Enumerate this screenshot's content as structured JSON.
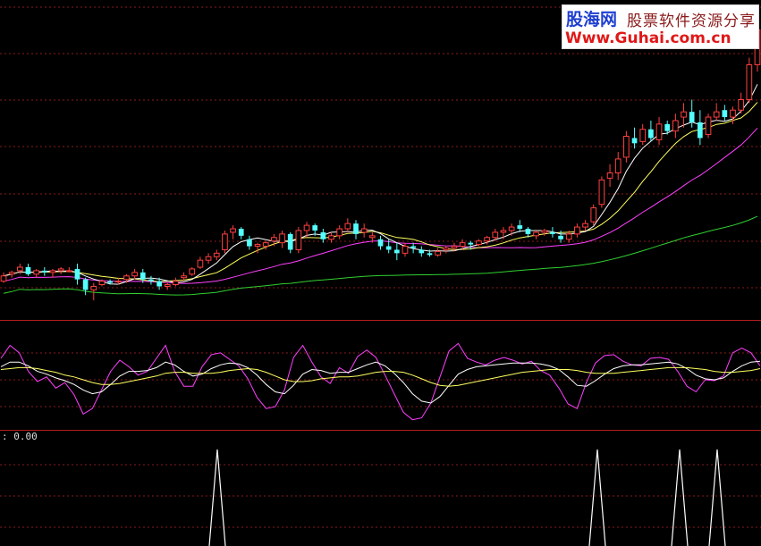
{
  "watermark": {
    "brand": "股海网",
    "tagline": "股票软件资源分享",
    "url": "Www.Guhai.com.cn"
  },
  "indicator_readout": ": 0.00",
  "colors": {
    "background": "#000000",
    "grid": "#8b1a1a",
    "panel_border": "#b41e1e",
    "candle_up": "#ff4040",
    "candle_down": "#54ffff",
    "ma_short": "#ffffff",
    "ma_mid": "#ffff60",
    "ma_long": "#ff40ff",
    "ma_longest": "#30d030",
    "signal": "#ffffff"
  },
  "chart_data": [
    {
      "type": "candlestick",
      "panel": "price",
      "ylim": [
        0,
        100
      ],
      "candles": [
        [
          48,
          53,
          47,
          51
        ],
        [
          52,
          54,
          50,
          53
        ],
        [
          54,
          58,
          52,
          56
        ],
        [
          56,
          58,
          51,
          52
        ],
        [
          52,
          55,
          50,
          54
        ],
        [
          54,
          56,
          51,
          53
        ],
        [
          53,
          55,
          50,
          54
        ],
        [
          54,
          56,
          52,
          55
        ],
        [
          54,
          56,
          53,
          54
        ],
        [
          55,
          58,
          46,
          49
        ],
        [
          49,
          50,
          40,
          43
        ],
        [
          43,
          47,
          37,
          45
        ],
        [
          46,
          49,
          45,
          48
        ],
        [
          48,
          49,
          46,
          47
        ],
        [
          48,
          50,
          46,
          48
        ],
        [
          49,
          52,
          47,
          51
        ],
        [
          51,
          55,
          49,
          53
        ],
        [
          53,
          55,
          47,
          49
        ],
        [
          49,
          51,
          46,
          48
        ],
        [
          48,
          50,
          43,
          45
        ],
        [
          45,
          47,
          43,
          46
        ],
        [
          46,
          50,
          45,
          48
        ],
        [
          50,
          53,
          48,
          51
        ],
        [
          52,
          56,
          51,
          55
        ],
        [
          56,
          62,
          55,
          60
        ],
        [
          60,
          64,
          58,
          62
        ],
        [
          62,
          66,
          60,
          64
        ],
        [
          66,
          77,
          64,
          75
        ],
        [
          76,
          80,
          72,
          78
        ],
        [
          78,
          79,
          72,
          74
        ],
        [
          72,
          74,
          66,
          68
        ],
        [
          68,
          70,
          64,
          69
        ],
        [
          68,
          71,
          66,
          70
        ],
        [
          71,
          75,
          68,
          73
        ],
        [
          70,
          77,
          67,
          75
        ],
        [
          75,
          76,
          64,
          66
        ],
        [
          66,
          79,
          64,
          77
        ],
        [
          77,
          82,
          73,
          80
        ],
        [
          80,
          81,
          74,
          77
        ],
        [
          76,
          78,
          70,
          72
        ],
        [
          72,
          76,
          70,
          74
        ],
        [
          74,
          80,
          72,
          78
        ],
        [
          78,
          84,
          76,
          81
        ],
        [
          81,
          83,
          72,
          75
        ],
        [
          76,
          81,
          73,
          78
        ],
        [
          73,
          76,
          70,
          74
        ],
        [
          72,
          74,
          66,
          68
        ],
        [
          68,
          72,
          64,
          66
        ],
        [
          66,
          70,
          60,
          64
        ],
        [
          64,
          70,
          62,
          68
        ],
        [
          68,
          70,
          64,
          67
        ],
        [
          66,
          68,
          62,
          64
        ],
        [
          64,
          66,
          62,
          63
        ],
        [
          63,
          67,
          62,
          65
        ],
        [
          66,
          68,
          64,
          67
        ],
        [
          67,
          70,
          65,
          68
        ],
        [
          68,
          72,
          66,
          70
        ],
        [
          70,
          71,
          66,
          69
        ],
        [
          69,
          72,
          68,
          71
        ],
        [
          71,
          74,
          69,
          73
        ],
        [
          73,
          78,
          71,
          76
        ],
        [
          76,
          79,
          72,
          77
        ],
        [
          77,
          81,
          74,
          79
        ],
        [
          80,
          83,
          76,
          78
        ],
        [
          78,
          79,
          73,
          75
        ],
        [
          74,
          77,
          72,
          76
        ],
        [
          76,
          78,
          74,
          77
        ],
        [
          76,
          79,
          73,
          75
        ],
        [
          74,
          77,
          70,
          72
        ],
        [
          72,
          77,
          70,
          75
        ],
        [
          75,
          81,
          73,
          79
        ],
        [
          79,
          83,
          77,
          81
        ],
        [
          82,
          92,
          80,
          90
        ],
        [
          92,
          108,
          90,
          106
        ],
        [
          107,
          115,
          102,
          110
        ],
        [
          110,
          122,
          106,
          118
        ],
        [
          119,
          134,
          116,
          131
        ],
        [
          130,
          136,
          124,
          127
        ],
        [
          128,
          138,
          126,
          135
        ],
        [
          135,
          140,
          128,
          130
        ],
        [
          129,
          142,
          126,
          138
        ],
        [
          138,
          140,
          132,
          134
        ],
        [
          134,
          144,
          130,
          140
        ],
        [
          142,
          150,
          136,
          145
        ],
        [
          145,
          152,
          136,
          139
        ],
        [
          139,
          146,
          126,
          130
        ],
        [
          132,
          144,
          130,
          142
        ],
        [
          142,
          150,
          140,
          145
        ],
        [
          146,
          149,
          140,
          142
        ],
        [
          142,
          148,
          138,
          146
        ],
        [
          146,
          156,
          144,
          152
        ],
        [
          152,
          176,
          150,
          172
        ],
        [
          172,
          196,
          168,
          192
        ]
      ],
      "moving_averages": [
        "MA5",
        "MA10",
        "MA20",
        "MA60"
      ],
      "grid": true
    },
    {
      "type": "line",
      "panel": "oscillator",
      "ylim": [
        0,
        100
      ],
      "series": [
        {
          "name": "",
          "color": "#ff40ff",
          "values": [
            74,
            88,
            80,
            60,
            49,
            54,
            42,
            48,
            35,
            14,
            20,
            40,
            60,
            72,
            65,
            56,
            60,
            74,
            88,
            60,
            44,
            44,
            65,
            78,
            80,
            73,
            66,
            52,
            32,
            20,
            22,
            40,
            75,
            88,
            70,
            54,
            47,
            64,
            58,
            76,
            83,
            75,
            56,
            36,
            16,
            8,
            10,
            26,
            54,
            82,
            90,
            74,
            70,
            67,
            72,
            75,
            72,
            68,
            71,
            61,
            56,
            42,
            25,
            20,
            48,
            69,
            77,
            78,
            71,
            67,
            66,
            74,
            75,
            73,
            60,
            44,
            38,
            51,
            50,
            55,
            80,
            85,
            80,
            66
          ]
        },
        {
          "name": "",
          "color": "#ffffff",
          "values": [
            65,
            70,
            70,
            66,
            60,
            57,
            53,
            50,
            46,
            40,
            36,
            38,
            46,
            55,
            60,
            60,
            61,
            64,
            70,
            67,
            60,
            55,
            57,
            63,
            67,
            69,
            68,
            64,
            56,
            46,
            38,
            36,
            45,
            57,
            62,
            61,
            58,
            59,
            59,
            63,
            67,
            70,
            66,
            58,
            48,
            36,
            28,
            26,
            33,
            45,
            57,
            62,
            65,
            66,
            67,
            68,
            69,
            69,
            69,
            68,
            66,
            62,
            54,
            45,
            44,
            50,
            57,
            63,
            66,
            67,
            67,
            68,
            69,
            70,
            68,
            63,
            56,
            52,
            51,
            53,
            60,
            66,
            70,
            71
          ]
        },
        {
          "name": "",
          "color": "#ffff60",
          "values": [
            62,
            63,
            64,
            64,
            63,
            61,
            59,
            56,
            54,
            51,
            48,
            46,
            46,
            47,
            49,
            51,
            53,
            55,
            58,
            59,
            59,
            58,
            58,
            58,
            59,
            61,
            62,
            63,
            62,
            59,
            55,
            51,
            49,
            49,
            50,
            52,
            53,
            54,
            54,
            55,
            57,
            59,
            60,
            60,
            59,
            56,
            52,
            48,
            45,
            44,
            45,
            47,
            49,
            51,
            53,
            55,
            57,
            59,
            60,
            61,
            62,
            62,
            62,
            61,
            59,
            58,
            58,
            58,
            59,
            60,
            61,
            62,
            63,
            64,
            64,
            64,
            63,
            62,
            60,
            59,
            59,
            60,
            61,
            63
          ]
        }
      ]
    },
    {
      "type": "signal",
      "panel": "signal",
      "ylim": [
        0,
        1
      ],
      "label": ": 0.00",
      "values": [
        0,
        1,
        1,
        1,
        1,
        0
      ]
    }
  ]
}
